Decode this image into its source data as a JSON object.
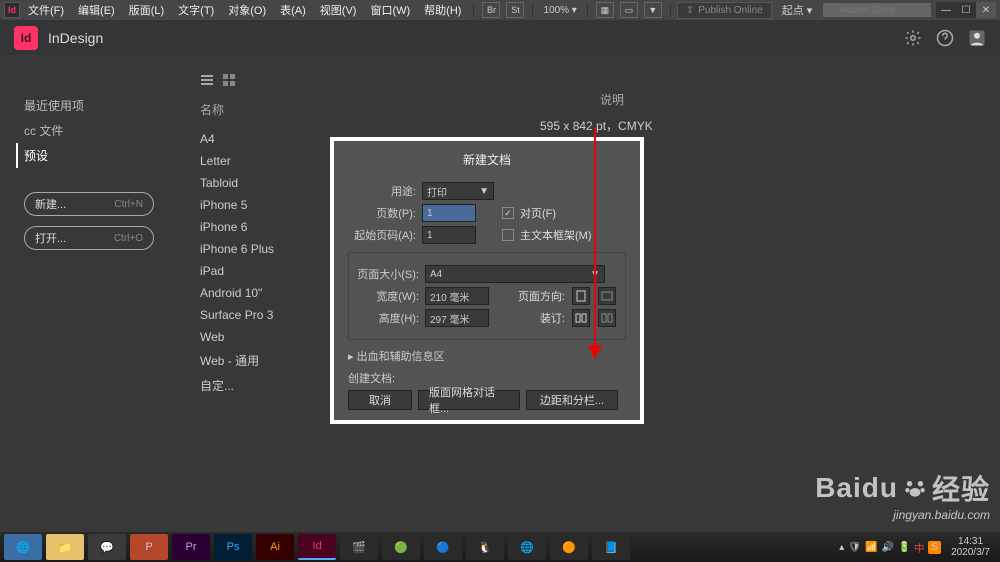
{
  "menubar": {
    "file": "文件(F)",
    "edit": "编辑(E)",
    "layout": "版面(L)",
    "type": "文字(T)",
    "object": "对象(O)",
    "table": "表(A)",
    "view": "视图(V)",
    "window": "窗口(W)",
    "help": "帮助(H)",
    "br": "Br",
    "st": "St",
    "zoom": "100%",
    "publish": "Publish Online",
    "origin": "起点",
    "search_placeholder": "Adobe Stock"
  },
  "app": {
    "title": "InDesign"
  },
  "nav": {
    "recent": "最近使用项",
    "ccfiles": "cc 文件",
    "presets": "预设",
    "new": "新建...",
    "new_sc": "Ctrl+N",
    "open": "打开...",
    "open_sc": "Ctrl+O"
  },
  "list": {
    "name_hdr": "名称",
    "desc_hdr": "说明",
    "desc_val": "595 x 842 pt，CMYK",
    "items": [
      "A4",
      "Letter",
      "Tabloid",
      "iPhone 5",
      "iPhone 6",
      "iPhone 6 Plus",
      "iPad",
      "Android 10\"",
      "Surface Pro 3",
      "Web",
      "Web - 通用",
      "自定..."
    ]
  },
  "dialog": {
    "title": "新建文档",
    "purpose_label": "用途:",
    "purpose_value": "打印",
    "pages_label": "页数(P):",
    "pages_value": "1",
    "facing_label": "对页(F)",
    "startpage_label": "起始页码(A):",
    "startpage_value": "1",
    "textframe_label": "主文本框架(M)",
    "pagesize_label": "页面大小(S):",
    "pagesize_value": "A4",
    "width_label": "宽度(W):",
    "width_value": "210 毫米",
    "height_label": "高度(H):",
    "height_value": "297 毫米",
    "orient_label": "页面方向:",
    "binding_label": "装订:",
    "bleed_section": "出血和辅助信息区",
    "create_label": "创建文档:",
    "cancel": "取消",
    "grid": "版面网格对话框...",
    "margins": "边距和分栏..."
  },
  "watermark": {
    "brand": "Baidu",
    "cn": "经验",
    "sub": "jingyan.baidu.com"
  },
  "taskbar": {
    "time": "14:31",
    "date": "2020/3/7"
  }
}
